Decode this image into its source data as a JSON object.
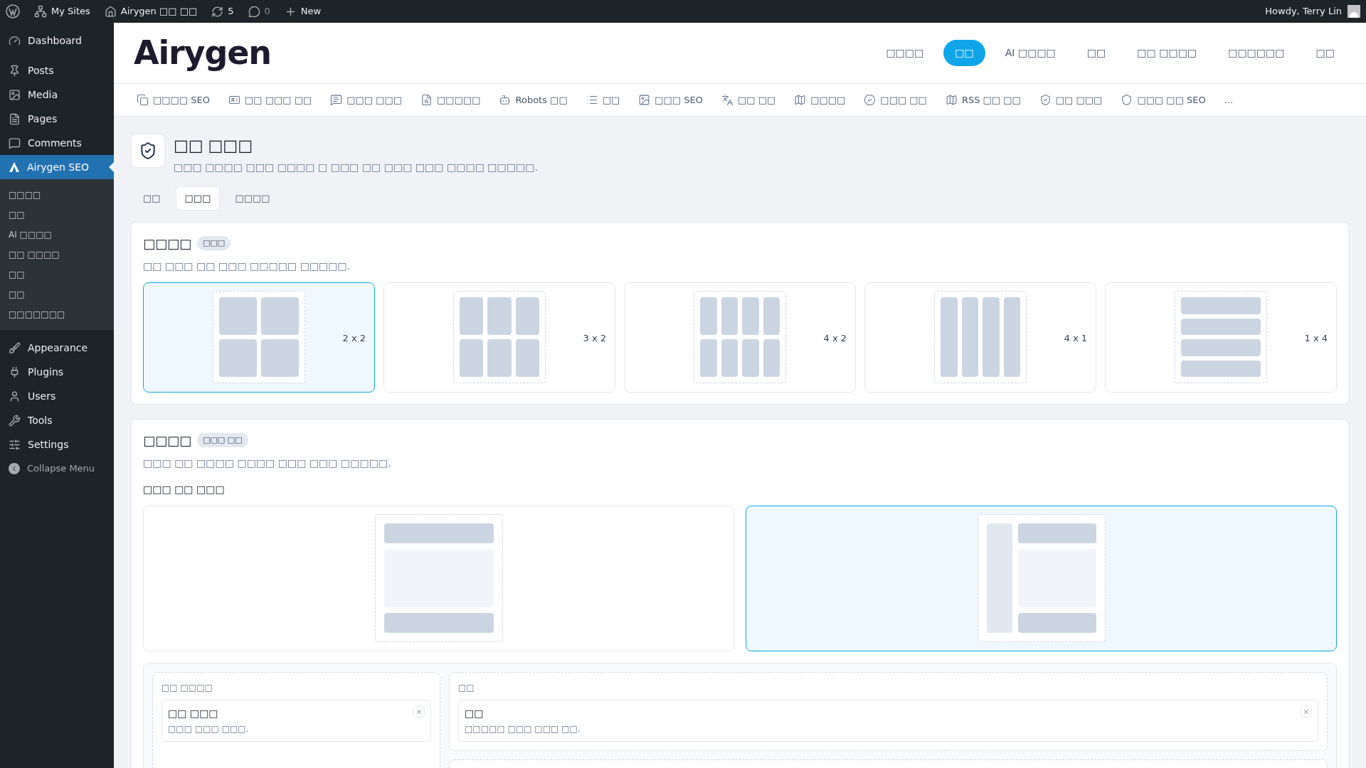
{
  "admin_bar": {
    "items": [
      {
        "kind": "sites",
        "label": "My Sites"
      },
      {
        "kind": "home",
        "label": "Airygen □□ □□"
      },
      {
        "kind": "updates",
        "label": "5"
      },
      {
        "kind": "comments",
        "label": "0"
      },
      {
        "kind": "new",
        "label": "New"
      }
    ],
    "greeting": "Howdy, Terry Lin"
  },
  "sidebar": {
    "items": [
      {
        "kind": "dashboard",
        "label": "Dashboard",
        "selected": false
      },
      {
        "kind": "posts",
        "label": "Posts",
        "selected": false
      },
      {
        "kind": "media",
        "label": "Media",
        "selected": false
      },
      {
        "kind": "pages",
        "label": "Pages",
        "selected": false
      },
      {
        "kind": "comments",
        "label": "Comments",
        "selected": false
      },
      {
        "kind": "plugin",
        "label": "Airygen SEO",
        "selected": true,
        "children": [
          "□□□□",
          "□□",
          "AI □□□□",
          "□□ □□□□",
          "□□",
          "□□",
          "□□□□□□□"
        ]
      },
      {
        "kind": "appearance",
        "label": "Appearance",
        "selected": false
      },
      {
        "kind": "plugins",
        "label": "Plugins",
        "selected": false
      },
      {
        "kind": "users",
        "label": "Users",
        "selected": false
      },
      {
        "kind": "tools",
        "label": "Tools",
        "selected": false
      },
      {
        "kind": "settings",
        "label": "Settings",
        "selected": false
      }
    ],
    "collapse": "Collapse Menu"
  },
  "header": {
    "logo": "Airygen",
    "nav": [
      {
        "label": "□□□□",
        "selected": false
      },
      {
        "label": "□□",
        "selected": true
      },
      {
        "label": "AI □□□□",
        "selected": false
      },
      {
        "label": "□□",
        "selected": false
      },
      {
        "label": "□□ □□□□",
        "selected": false
      },
      {
        "label": "□□□□□□",
        "selected": false
      },
      {
        "label": "□□",
        "selected": false
      }
    ]
  },
  "module_tabs": [
    {
      "kind": "copy",
      "label": "□□□□ SEO"
    },
    {
      "kind": "card",
      "label": "□□ □□□ □□"
    },
    {
      "kind": "message",
      "label": "□□□ □□□"
    },
    {
      "kind": "file",
      "label": "□□□□□"
    },
    {
      "kind": "bot",
      "label": "Robots □□"
    },
    {
      "kind": "list",
      "label": "□□"
    },
    {
      "kind": "image",
      "label": "□□□ SEO"
    },
    {
      "kind": "translate",
      "label": "□□ □□"
    },
    {
      "kind": "map",
      "label": "□□□□"
    },
    {
      "kind": "check",
      "label": "□□□ □□"
    },
    {
      "kind": "map",
      "label": "RSS □□ □□"
    },
    {
      "kind": "shield-link",
      "label": "□□ □□□"
    },
    {
      "kind": "shield",
      "label": "□□□ □□ SEO"
    },
    {
      "kind": "more",
      "label": "..."
    }
  ],
  "page": {
    "title": "□□ □□□",
    "description": "□□□ □□□□ □□□ □□□□ □ □□□ □□ □□□ □□□ □□□□ □□□□□.",
    "subtabs": [
      {
        "label": "□□",
        "selected": false
      },
      {
        "label": "□□□",
        "selected": true
      },
      {
        "label": "□□□□",
        "selected": false
      }
    ]
  },
  "grid_section": {
    "title": "□□□□",
    "badge": "□□□",
    "description": "□□ □□□ □□ □□□ □□□□□ □□□□□.",
    "options": [
      {
        "kind": "square",
        "label": "2 x 2",
        "selected": true
      },
      {
        "kind": "wide",
        "label": "3 x 2",
        "selected": false
      },
      {
        "kind": "dense",
        "label": "4 x 2",
        "selected": false
      },
      {
        "kind": "columns",
        "label": "4 x 1",
        "selected": false
      },
      {
        "kind": "rows",
        "label": "1 x 4",
        "selected": false
      }
    ]
  },
  "layout_section": {
    "title": "□□□□",
    "badge": "□□□ □□",
    "description": "□□□ □□ □□□□ □□□□ □□□ □□□ □□□□□.",
    "label": "□□□ □□ □□□",
    "options": [
      {
        "kind": "stacked",
        "selected": false
      },
      {
        "kind": "sidebar",
        "selected": true
      }
    ],
    "columns": [
      {
        "title": "□□ □□□□",
        "items": [
          {
            "title": "□□ □□□",
            "description": "□□□ □□□ □□□."
          }
        ]
      },
      {
        "title": "□□",
        "items": [
          {
            "title": "□□",
            "description": "□□□□□ □□□ □□□ □□."
          }
        ]
      }
    ]
  }
}
